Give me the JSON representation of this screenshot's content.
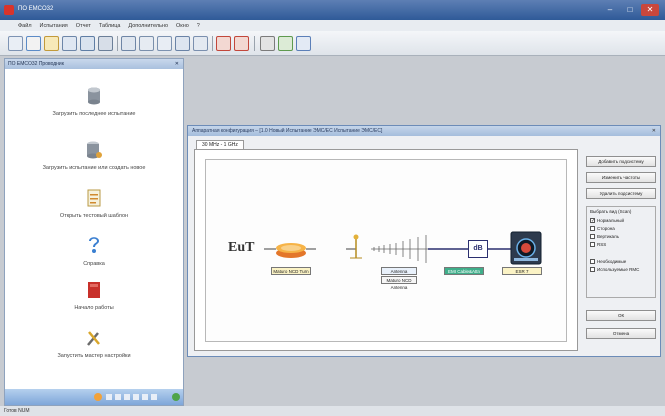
{
  "window": {
    "title": "ПО EMCO32",
    "buttons": [
      "–",
      "□",
      "✕"
    ]
  },
  "menu": [
    "Файл",
    "Испытания",
    "Отчет",
    "Таблица",
    "Дополнительно",
    "Окно",
    "?"
  ],
  "toolbar_icons": [
    "new-icon",
    "chart-icon",
    "table-icon",
    "open-icon",
    "print-icon",
    "save-icon",
    "device-icon",
    "measure-icon",
    "library-icon",
    "scan-icon",
    "antenna-icon",
    "settings-icon",
    "tools-icon",
    "edit-icon",
    "network-icon"
  ],
  "left_panel": {
    "title": "ПО EMCO32 Проводник",
    "items": [
      {
        "label": "Загрузить последнее испытание",
        "icon": "database-icon"
      },
      {
        "label": "Загрузить испытание или создать новое",
        "icon": "database-add-icon"
      },
      {
        "label": "Открыть тестовый шаблон",
        "icon": "template-icon"
      },
      {
        "label": "Справка",
        "icon": "help-icon"
      },
      {
        "label": "Начало работы",
        "icon": "book-icon"
      },
      {
        "label": "Запустить мастер настройки",
        "icon": "wizard-icon"
      }
    ]
  },
  "dialog": {
    "title": "Аппаратная конфигурация – [1.0 Новый Испытание ЭМС/ЕС Испытание ЭМС/ЕС]",
    "tab": "30 MHz - 1 GHz",
    "diagram": {
      "eut_label": "EuT",
      "turntable_label": "Maturo NCD Turn",
      "antenna_label": "Antenna HL562E",
      "antenna_mast_label": "Maturo NCD Antenna",
      "cable_label": "EMI Cable&Attn",
      "attenuator_label": "dB",
      "receiver_label": "ESR 7"
    },
    "buttons": {
      "add_device": "Добавить подсистему",
      "remove_parts": "Изменить частоты",
      "delete_device": "Удалить подсистему",
      "ok": "ОК",
      "cancel": "Отмена"
    },
    "group": {
      "label": "Выбрать вид (Scan)",
      "options": [
        {
          "label": "Нормальный",
          "checked": true
        },
        {
          "label": "Сторона",
          "checked": false
        },
        {
          "label": "Вертикаль",
          "checked": false
        },
        {
          "label": "RSS",
          "checked": false
        },
        {
          "label": "Необходимые",
          "checked": false
        },
        {
          "label": "Используемые RMC",
          "checked": false
        }
      ]
    }
  },
  "statusbar": {
    "text": "Готов  NUM"
  }
}
